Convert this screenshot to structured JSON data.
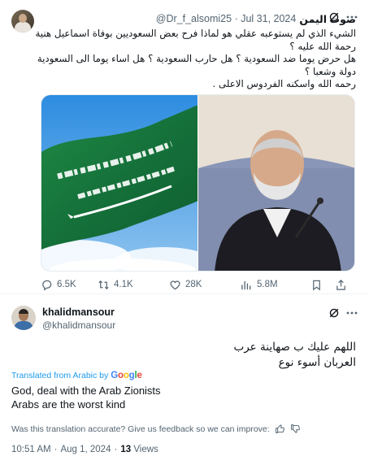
{
  "quoted_post": {
    "author_name": "صوت اليمن",
    "handle": "@Dr_f_alsomi25",
    "separator": "·",
    "date": "Jul 31, 2024",
    "text_lines": [
      "الشيء الذي لم يستوعبه عقلي هو لماذا فرح بعض السعوديين بوفاة اسماعيل هنية رحمة الله عليه ؟",
      "هل حرض يوما ضد السعودية ؟ هل حارب السعودية ؟ هل اساء يوما الى السعودية دولة وشعبا ؟",
      "رحمه الله واسكنه الفردوس الاعلى ."
    ],
    "metrics": {
      "replies": "6.5K",
      "reposts": "4.1K",
      "likes": "28K",
      "views": "5.8M"
    }
  },
  "post": {
    "author_name": "khalidmansour",
    "handle": "@khalidmansour",
    "text_lines": [
      "اللهم عليك ب صهاينة عرب",
      "العربان أسوء نوع"
    ],
    "translated_from": "Translated from Arabic by",
    "google_letters": [
      "G",
      "o",
      "o",
      "g",
      "l",
      "e"
    ],
    "translation_lines": [
      "God, deal with the Arab Zionists",
      "Arabs are the worst kind"
    ],
    "feedback_text": "Was this translation accurate? Give us feedback so we can improve:",
    "time": "10:51 AM",
    "separator": "·",
    "date": "Aug 1, 2024",
    "separator2": "·",
    "views_count": "13",
    "views_label": "Views"
  },
  "colors": {
    "accent": "#1d9bf0",
    "secondary_text": "#536471",
    "primary_text": "#0f1419",
    "flag_green": "#1a7a3c"
  },
  "icons": [
    "grok-icon",
    "more-icon",
    "reply-icon",
    "repost-icon",
    "like-icon",
    "views-icon",
    "bookmark-icon",
    "share-icon",
    "thumbs-up-icon",
    "thumbs-down-icon"
  ]
}
